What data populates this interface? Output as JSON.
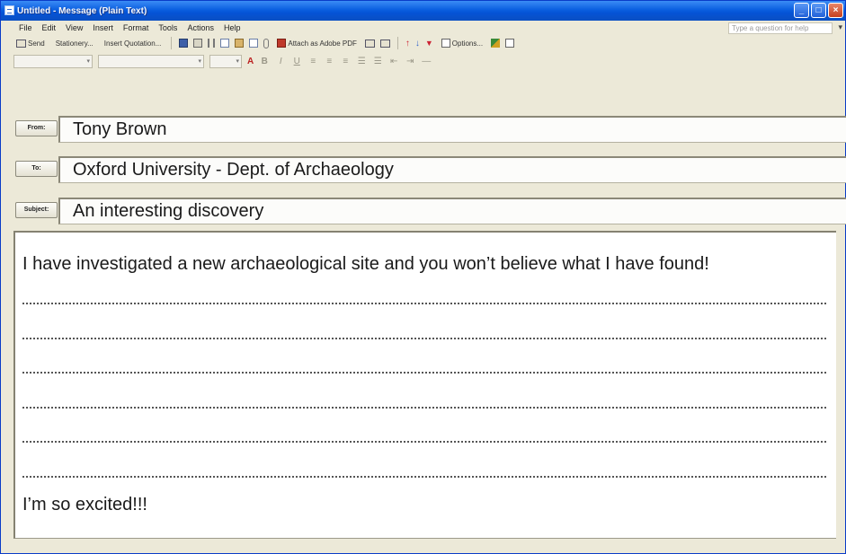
{
  "window": {
    "title": "Untitled - Message (Plain Text)",
    "controls": [
      "_",
      "□",
      "×"
    ]
  },
  "menu": [
    "File",
    "Edit",
    "View",
    "Insert",
    "Format",
    "Tools",
    "Actions",
    "Help"
  ],
  "help_box": {
    "placeholder": "Type a question for help"
  },
  "toolbar": {
    "send_label": "Send",
    "stationery_label": "Stationery...",
    "insert_quotation_label": "Insert Quotation...",
    "attach_pdf_label": "Attach as Adobe PDF",
    "options_label": "Options..."
  },
  "header": {
    "from_label": "From:",
    "from_value": "Tony Brown",
    "to_label": "To:",
    "to_value": "Oxford University - Dept. of Archaeology",
    "subject_label": "Subject:",
    "subject_value": "An interesting discovery"
  },
  "body": {
    "first_line": "I have investigated a new archaeological site and you won’t believe what I have found!",
    "blank_line_count": 6,
    "last_line": "I’m so excited!!!"
  },
  "colors": {
    "titlebar": "#0a5fe0",
    "chrome": "#ece9d8"
  }
}
